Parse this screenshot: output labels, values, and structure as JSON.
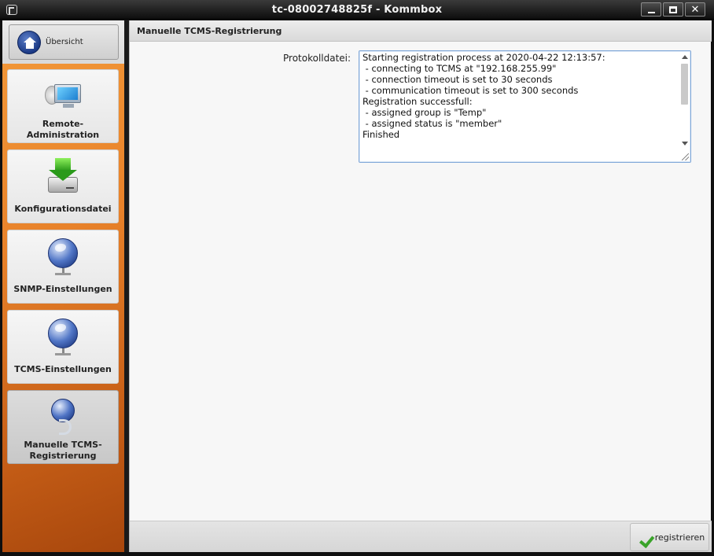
{
  "window": {
    "title": "tc-08002748825f - Kommbox"
  },
  "sidebar": {
    "overview_label": "Übersicht",
    "items": [
      {
        "label": "Remote-\nAdministration",
        "icon": "remote-admin-icon"
      },
      {
        "label": "Konfigurationsdatei",
        "icon": "download-drive-icon"
      },
      {
        "label": "SNMP-Einstellungen",
        "icon": "globe-network-icon"
      },
      {
        "label": "TCMS-Einstellungen",
        "icon": "globe-network-icon"
      },
      {
        "label": "Manuelle TCMS-\nRegistrierung",
        "icon": "globe-cable-icon",
        "active": true
      }
    ]
  },
  "main": {
    "header": "Manuelle TCMS-Registrierung",
    "log_label": "Protokolldatei:",
    "log_text": "Starting registration process at 2020-04-22 12:13:57:\n - connecting to TCMS at \"192.168.255.99\"\n - connection timeout is set to 30 seconds\n - communication timeout is set to 300 seconds\nRegistration successfull:\n - assigned group is \"Temp\"\n - assigned status is \"member\"\nFinished",
    "register_label": "registrieren"
  },
  "colors": {
    "sidebar_accent": "#e8822a",
    "check_green": "#3aa32a",
    "log_border": "#7fa7d8"
  }
}
